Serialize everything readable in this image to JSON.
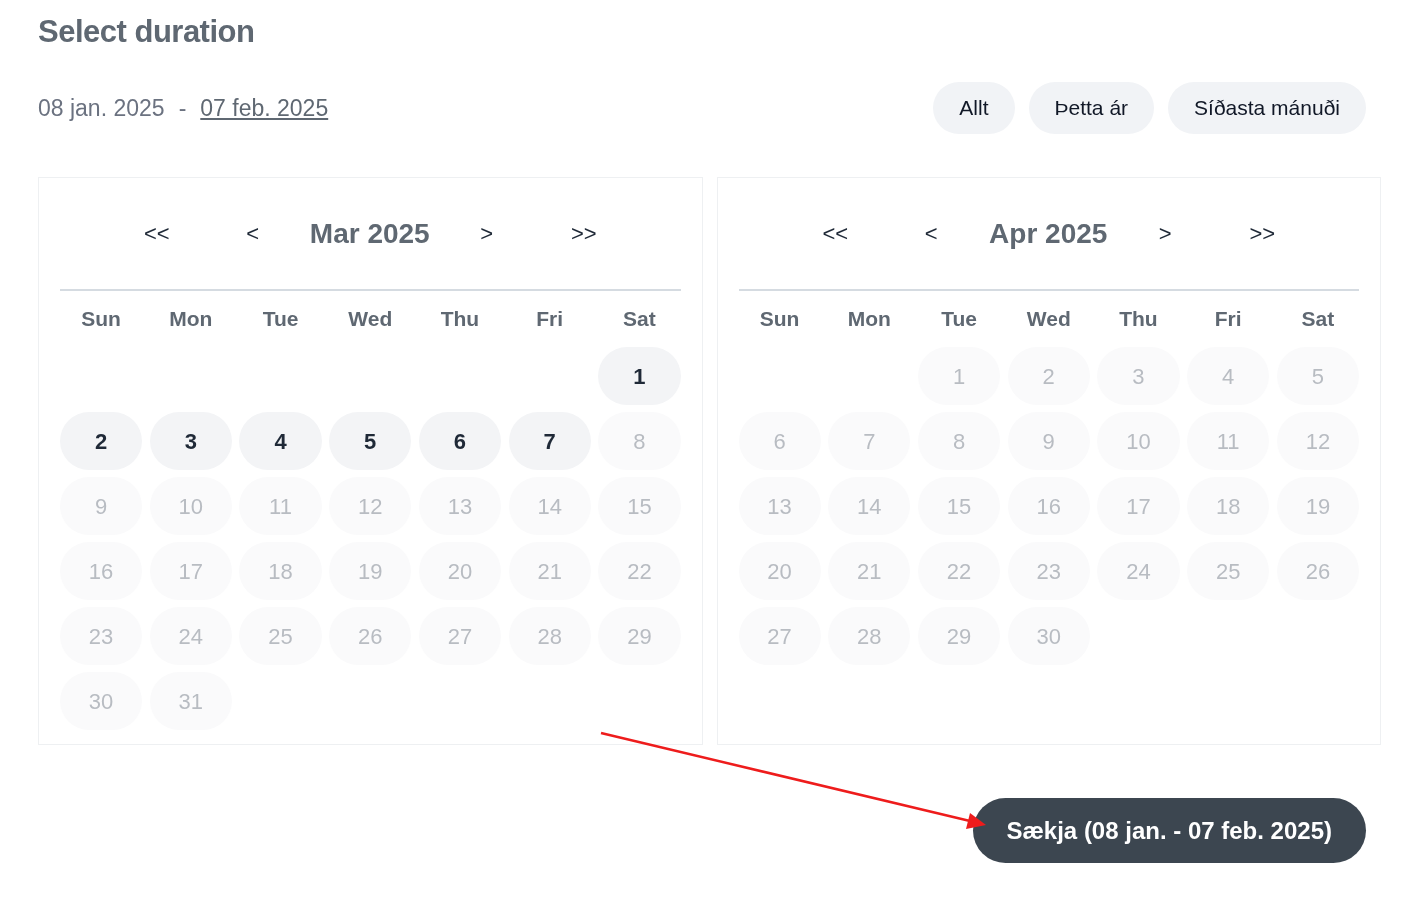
{
  "title": "Select duration",
  "range": {
    "start": "08 jan. 2025",
    "separator": "-",
    "end": "07 feb. 2025"
  },
  "presets": [
    {
      "label": "Allt"
    },
    {
      "label": "Þetta ár"
    },
    {
      "label": "Síðasta mánuði"
    }
  ],
  "calendars": [
    {
      "nav": {
        "prev_year": "<<",
        "prev_month": "<",
        "next_month": ">",
        "next_year": ">>"
      },
      "month": "Mar 2025",
      "weekdays": [
        "Sun",
        "Mon",
        "Tue",
        "Wed",
        "Thu",
        "Fri",
        "Sat"
      ],
      "weeks": [
        [
          {
            "kind": "blank"
          },
          {
            "kind": "blank"
          },
          {
            "kind": "blank"
          },
          {
            "kind": "blank"
          },
          {
            "kind": "blank"
          },
          {
            "kind": "blank"
          },
          {
            "kind": "day",
            "day": "1",
            "disabled": false
          }
        ],
        [
          {
            "kind": "day",
            "day": "2",
            "disabled": false
          },
          {
            "kind": "day",
            "day": "3",
            "disabled": false
          },
          {
            "kind": "day",
            "day": "4",
            "disabled": false
          },
          {
            "kind": "day",
            "day": "5",
            "disabled": false
          },
          {
            "kind": "day",
            "day": "6",
            "disabled": false
          },
          {
            "kind": "day",
            "day": "7",
            "disabled": false
          },
          {
            "kind": "day",
            "day": "8",
            "disabled": true
          }
        ],
        [
          {
            "kind": "day",
            "day": "9",
            "disabled": true
          },
          {
            "kind": "day",
            "day": "10",
            "disabled": true
          },
          {
            "kind": "day",
            "day": "11",
            "disabled": true
          },
          {
            "kind": "day",
            "day": "12",
            "disabled": true
          },
          {
            "kind": "day",
            "day": "13",
            "disabled": true
          },
          {
            "kind": "day",
            "day": "14",
            "disabled": true
          },
          {
            "kind": "day",
            "day": "15",
            "disabled": true
          }
        ],
        [
          {
            "kind": "day",
            "day": "16",
            "disabled": true
          },
          {
            "kind": "day",
            "day": "17",
            "disabled": true
          },
          {
            "kind": "day",
            "day": "18",
            "disabled": true
          },
          {
            "kind": "day",
            "day": "19",
            "disabled": true
          },
          {
            "kind": "day",
            "day": "20",
            "disabled": true
          },
          {
            "kind": "day",
            "day": "21",
            "disabled": true
          },
          {
            "kind": "day",
            "day": "22",
            "disabled": true
          }
        ],
        [
          {
            "kind": "day",
            "day": "23",
            "disabled": true
          },
          {
            "kind": "day",
            "day": "24",
            "disabled": true
          },
          {
            "kind": "day",
            "day": "25",
            "disabled": true
          },
          {
            "kind": "day",
            "day": "26",
            "disabled": true
          },
          {
            "kind": "day",
            "day": "27",
            "disabled": true
          },
          {
            "kind": "day",
            "day": "28",
            "disabled": true
          },
          {
            "kind": "day",
            "day": "29",
            "disabled": true
          }
        ],
        [
          {
            "kind": "day",
            "day": "30",
            "disabled": true
          },
          {
            "kind": "day",
            "day": "31",
            "disabled": true
          }
        ]
      ]
    },
    {
      "nav": {
        "prev_year": "<<",
        "prev_month": "<",
        "next_month": ">",
        "next_year": ">>"
      },
      "month": "Apr 2025",
      "weekdays": [
        "Sun",
        "Mon",
        "Tue",
        "Wed",
        "Thu",
        "Fri",
        "Sat"
      ],
      "weeks": [
        [
          {
            "kind": "blank"
          },
          {
            "kind": "blank"
          },
          {
            "kind": "day",
            "day": "1",
            "disabled": true
          },
          {
            "kind": "day",
            "day": "2",
            "disabled": true
          },
          {
            "kind": "day",
            "day": "3",
            "disabled": true
          },
          {
            "kind": "day",
            "day": "4",
            "disabled": true
          },
          {
            "kind": "day",
            "day": "5",
            "disabled": true
          }
        ],
        [
          {
            "kind": "day",
            "day": "6",
            "disabled": true
          },
          {
            "kind": "day",
            "day": "7",
            "disabled": true
          },
          {
            "kind": "day",
            "day": "8",
            "disabled": true
          },
          {
            "kind": "day",
            "day": "9",
            "disabled": true
          },
          {
            "kind": "day",
            "day": "10",
            "disabled": true
          },
          {
            "kind": "day",
            "day": "11",
            "disabled": true
          },
          {
            "kind": "day",
            "day": "12",
            "disabled": true
          }
        ],
        [
          {
            "kind": "day",
            "day": "13",
            "disabled": true
          },
          {
            "kind": "day",
            "day": "14",
            "disabled": true
          },
          {
            "kind": "day",
            "day": "15",
            "disabled": true
          },
          {
            "kind": "day",
            "day": "16",
            "disabled": true
          },
          {
            "kind": "day",
            "day": "17",
            "disabled": true
          },
          {
            "kind": "day",
            "day": "18",
            "disabled": true
          },
          {
            "kind": "day",
            "day": "19",
            "disabled": true
          }
        ],
        [
          {
            "kind": "day",
            "day": "20",
            "disabled": true
          },
          {
            "kind": "day",
            "day": "21",
            "disabled": true
          },
          {
            "kind": "day",
            "day": "22",
            "disabled": true
          },
          {
            "kind": "day",
            "day": "23",
            "disabled": true
          },
          {
            "kind": "day",
            "day": "24",
            "disabled": true
          },
          {
            "kind": "day",
            "day": "25",
            "disabled": true
          },
          {
            "kind": "day",
            "day": "26",
            "disabled": true
          }
        ],
        [
          {
            "kind": "day",
            "day": "27",
            "disabled": true
          },
          {
            "kind": "day",
            "day": "28",
            "disabled": true
          },
          {
            "kind": "day",
            "day": "29",
            "disabled": true
          },
          {
            "kind": "day",
            "day": "30",
            "disabled": true
          }
        ]
      ]
    }
  ],
  "submit": {
    "label": "Sækja (08 jan. - 07 feb. 2025)"
  }
}
